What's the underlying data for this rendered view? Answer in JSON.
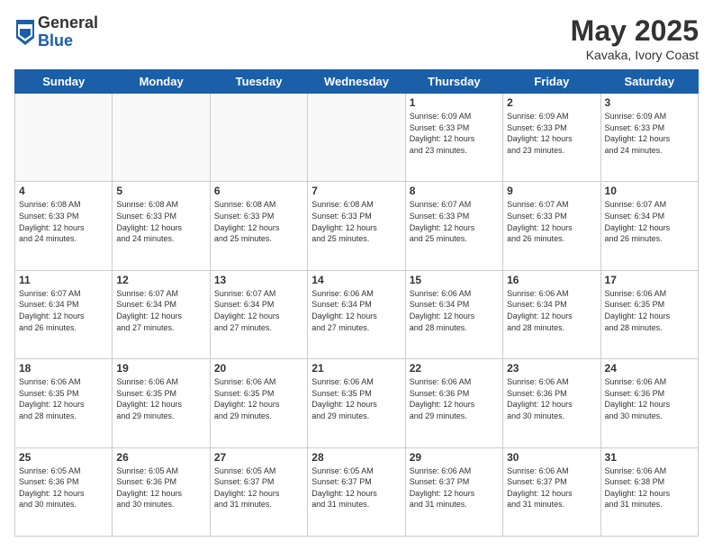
{
  "logo": {
    "general": "General",
    "blue": "Blue"
  },
  "title": "May 2025",
  "location": "Kavaka, Ivory Coast",
  "days_of_week": [
    "Sunday",
    "Monday",
    "Tuesday",
    "Wednesday",
    "Thursday",
    "Friday",
    "Saturday"
  ],
  "weeks": [
    [
      {
        "day": "",
        "info": ""
      },
      {
        "day": "",
        "info": ""
      },
      {
        "day": "",
        "info": ""
      },
      {
        "day": "",
        "info": ""
      },
      {
        "day": "1",
        "info": "Sunrise: 6:09 AM\nSunset: 6:33 PM\nDaylight: 12 hours\nand 23 minutes."
      },
      {
        "day": "2",
        "info": "Sunrise: 6:09 AM\nSunset: 6:33 PM\nDaylight: 12 hours\nand 23 minutes."
      },
      {
        "day": "3",
        "info": "Sunrise: 6:09 AM\nSunset: 6:33 PM\nDaylight: 12 hours\nand 24 minutes."
      }
    ],
    [
      {
        "day": "4",
        "info": "Sunrise: 6:08 AM\nSunset: 6:33 PM\nDaylight: 12 hours\nand 24 minutes."
      },
      {
        "day": "5",
        "info": "Sunrise: 6:08 AM\nSunset: 6:33 PM\nDaylight: 12 hours\nand 24 minutes."
      },
      {
        "day": "6",
        "info": "Sunrise: 6:08 AM\nSunset: 6:33 PM\nDaylight: 12 hours\nand 25 minutes."
      },
      {
        "day": "7",
        "info": "Sunrise: 6:08 AM\nSunset: 6:33 PM\nDaylight: 12 hours\nand 25 minutes."
      },
      {
        "day": "8",
        "info": "Sunrise: 6:07 AM\nSunset: 6:33 PM\nDaylight: 12 hours\nand 25 minutes."
      },
      {
        "day": "9",
        "info": "Sunrise: 6:07 AM\nSunset: 6:33 PM\nDaylight: 12 hours\nand 26 minutes."
      },
      {
        "day": "10",
        "info": "Sunrise: 6:07 AM\nSunset: 6:34 PM\nDaylight: 12 hours\nand 26 minutes."
      }
    ],
    [
      {
        "day": "11",
        "info": "Sunrise: 6:07 AM\nSunset: 6:34 PM\nDaylight: 12 hours\nand 26 minutes."
      },
      {
        "day": "12",
        "info": "Sunrise: 6:07 AM\nSunset: 6:34 PM\nDaylight: 12 hours\nand 27 minutes."
      },
      {
        "day": "13",
        "info": "Sunrise: 6:07 AM\nSunset: 6:34 PM\nDaylight: 12 hours\nand 27 minutes."
      },
      {
        "day": "14",
        "info": "Sunrise: 6:06 AM\nSunset: 6:34 PM\nDaylight: 12 hours\nand 27 minutes."
      },
      {
        "day": "15",
        "info": "Sunrise: 6:06 AM\nSunset: 6:34 PM\nDaylight: 12 hours\nand 28 minutes."
      },
      {
        "day": "16",
        "info": "Sunrise: 6:06 AM\nSunset: 6:34 PM\nDaylight: 12 hours\nand 28 minutes."
      },
      {
        "day": "17",
        "info": "Sunrise: 6:06 AM\nSunset: 6:35 PM\nDaylight: 12 hours\nand 28 minutes."
      }
    ],
    [
      {
        "day": "18",
        "info": "Sunrise: 6:06 AM\nSunset: 6:35 PM\nDaylight: 12 hours\nand 28 minutes."
      },
      {
        "day": "19",
        "info": "Sunrise: 6:06 AM\nSunset: 6:35 PM\nDaylight: 12 hours\nand 29 minutes."
      },
      {
        "day": "20",
        "info": "Sunrise: 6:06 AM\nSunset: 6:35 PM\nDaylight: 12 hours\nand 29 minutes."
      },
      {
        "day": "21",
        "info": "Sunrise: 6:06 AM\nSunset: 6:35 PM\nDaylight: 12 hours\nand 29 minutes."
      },
      {
        "day": "22",
        "info": "Sunrise: 6:06 AM\nSunset: 6:36 PM\nDaylight: 12 hours\nand 29 minutes."
      },
      {
        "day": "23",
        "info": "Sunrise: 6:06 AM\nSunset: 6:36 PM\nDaylight: 12 hours\nand 30 minutes."
      },
      {
        "day": "24",
        "info": "Sunrise: 6:06 AM\nSunset: 6:36 PM\nDaylight: 12 hours\nand 30 minutes."
      }
    ],
    [
      {
        "day": "25",
        "info": "Sunrise: 6:05 AM\nSunset: 6:36 PM\nDaylight: 12 hours\nand 30 minutes."
      },
      {
        "day": "26",
        "info": "Sunrise: 6:05 AM\nSunset: 6:36 PM\nDaylight: 12 hours\nand 30 minutes."
      },
      {
        "day": "27",
        "info": "Sunrise: 6:05 AM\nSunset: 6:37 PM\nDaylight: 12 hours\nand 31 minutes."
      },
      {
        "day": "28",
        "info": "Sunrise: 6:05 AM\nSunset: 6:37 PM\nDaylight: 12 hours\nand 31 minutes."
      },
      {
        "day": "29",
        "info": "Sunrise: 6:06 AM\nSunset: 6:37 PM\nDaylight: 12 hours\nand 31 minutes."
      },
      {
        "day": "30",
        "info": "Sunrise: 6:06 AM\nSunset: 6:37 PM\nDaylight: 12 hours\nand 31 minutes."
      },
      {
        "day": "31",
        "info": "Sunrise: 6:06 AM\nSunset: 6:38 PM\nDaylight: 12 hours\nand 31 minutes."
      }
    ]
  ]
}
